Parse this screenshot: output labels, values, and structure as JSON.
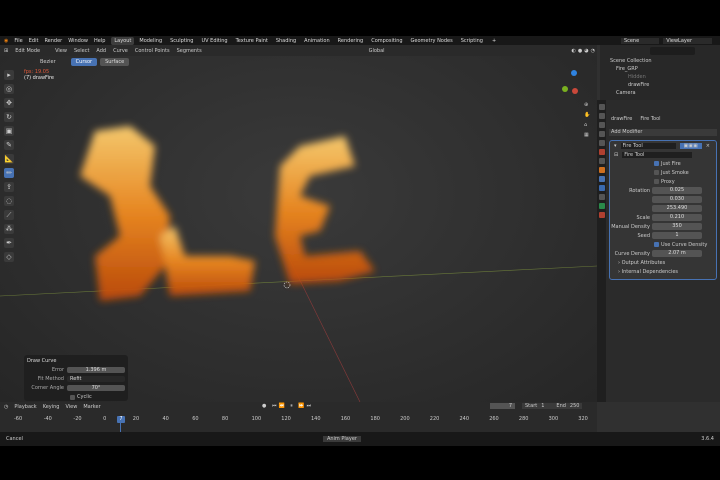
{
  "menu": [
    "File",
    "Edit",
    "Render",
    "Window",
    "Help"
  ],
  "workspaces": [
    "Layout",
    "Modeling",
    "Sculpting",
    "UV Editing",
    "Texture Paint",
    "Shading",
    "Animation",
    "Rendering",
    "Compositing",
    "Geometry Nodes",
    "Scripting"
  ],
  "active_workspace": "Layout",
  "scene": "Scene",
  "view_layer": "ViewLayer",
  "header": {
    "mode": "Edit Mode",
    "menus": [
      "View",
      "Select",
      "Add",
      "Curve",
      "Control Points",
      "Segments"
    ],
    "orientation": "Global"
  },
  "toolset": {
    "type": "Bezier",
    "tabs": [
      "Cursor",
      "Surface"
    ],
    "active": "Cursor"
  },
  "viewport_info": {
    "line1": "fps: 19.05",
    "line2": "(7) drawFire"
  },
  "redo_panel": {
    "title": "Draw Curve",
    "error_label": "Error",
    "error": "1.396 m",
    "fit_label": "Fit Method",
    "fit": "Refit",
    "corner_label": "Corner Angle",
    "corner": "70°",
    "cyclic": "Cyclic"
  },
  "outliner": {
    "root": "Scene Collection",
    "items": [
      "Fire_GRP",
      "Hidden",
      "drawFire",
      "Camera"
    ]
  },
  "properties": {
    "breadcrumb_obj": "drawFire",
    "breadcrumb_mod": "Fire Tool",
    "add_modifier": "Add Modifier",
    "modifier_name": "Fire Tool",
    "node_group": "Fire Tool",
    "just_fire": "Just Fire",
    "just_smoke": "Just Smoke",
    "proxy": "Proxy",
    "rotation_label": "Rotation",
    "rotation": [
      "0.025",
      "0.030",
      "253.490"
    ],
    "scale_label": "Scale",
    "scale": "0.210",
    "density_label": "Manual Density",
    "density": "350",
    "seed_label": "Seed",
    "seed": "1",
    "use_curve_density": "Use Curve Density",
    "curve_density_label": "Curve Density",
    "curve_density": "2.07 m",
    "output_attrs": "Output Attributes",
    "internal_deps": "Internal Dependencies"
  },
  "timeline": {
    "menus": [
      "Playback",
      "Keying",
      "View",
      "Marker"
    ],
    "current": "7",
    "start_label": "Start",
    "start": "1",
    "end_label": "End",
    "end": "250",
    "ticks": [
      "-60",
      "-40",
      "-20",
      "0",
      "20",
      "40",
      "60",
      "80",
      "100",
      "120",
      "140",
      "160",
      "180",
      "200",
      "220",
      "240",
      "260",
      "280",
      "300",
      "320"
    ]
  },
  "status": {
    "left": "Cancel",
    "center": "Anim Player",
    "version": "3.6.4"
  }
}
